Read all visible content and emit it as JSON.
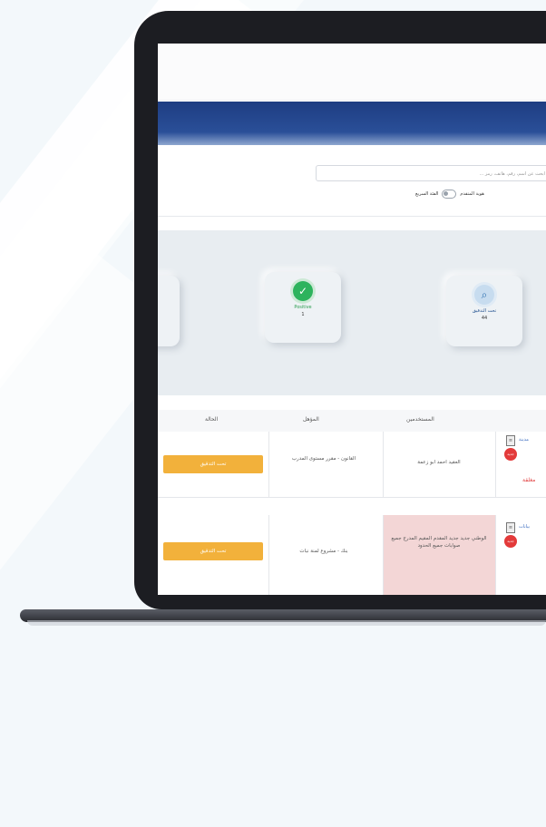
{
  "search": {
    "placeholder": "ابحث عن اسم، رقم، هاتف، رمز ...",
    "option_applicant": "هوية المتقدم",
    "option_quick": "الفئة السريع"
  },
  "stats": [
    {
      "label": "",
      "value": ""
    },
    {
      "label": "Positive",
      "value": "1"
    },
    {
      "label": "تحت التدقيق",
      "value": "44"
    }
  ],
  "table": {
    "headers": [
      "الحالة",
      "المؤهل",
      "المستخدمين"
    ],
    "rows": [
      {
        "action": "تحت التدقيق",
        "qualification": "القانون - مقرر مستوى المدرب",
        "user": "العقيد احمد ابو زعمة",
        "note": "مدينة",
        "status_text": "مغلقة",
        "badge": "جديد"
      },
      {
        "action": "تحت التدقيق",
        "qualification": "بنك - مشروع لمنة نبات",
        "user": "الوطني جديد جديد المقدم المقيم المدرج جميع صوابات جميع الحدود",
        "note": "بيانات",
        "status_text": "",
        "badge": "جديد"
      }
    ]
  },
  "colors": {
    "navbar": "#1e3d82",
    "button": "#f2b13b",
    "badge": "#e33a3a",
    "positive": "#2db35d"
  }
}
